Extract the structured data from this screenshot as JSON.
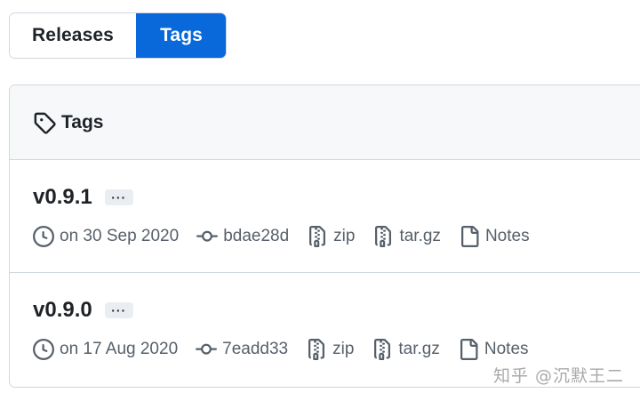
{
  "tabs": {
    "releases_label": "Releases",
    "tags_label": "Tags",
    "active": "Tags"
  },
  "card": {
    "header_title": "Tags"
  },
  "tags": [
    {
      "version": "v0.9.1",
      "more_label": "···",
      "date": "on 30 Sep 2020",
      "commit": "bdae28d",
      "zip_label": "zip",
      "targz_label": "tar.gz",
      "notes_label": "Notes"
    },
    {
      "version": "v0.9.0",
      "more_label": "···",
      "date": "on 17 Aug 2020",
      "commit": "7eadd33",
      "zip_label": "zip",
      "targz_label": "tar.gz",
      "notes_label": "Notes"
    }
  ],
  "watermark": "知乎 @沉默王二",
  "colors": {
    "accent": "#0969da",
    "border": "#d0d7de",
    "header_bg": "#f6f8fa",
    "muted_text": "#57606a",
    "text": "#1f2328"
  },
  "icons": {
    "header": "tag-icon",
    "date": "clock-icon",
    "commit": "git-commit-icon",
    "zip": "file-zip-icon",
    "targz": "file-zip-icon",
    "notes": "file-icon"
  }
}
